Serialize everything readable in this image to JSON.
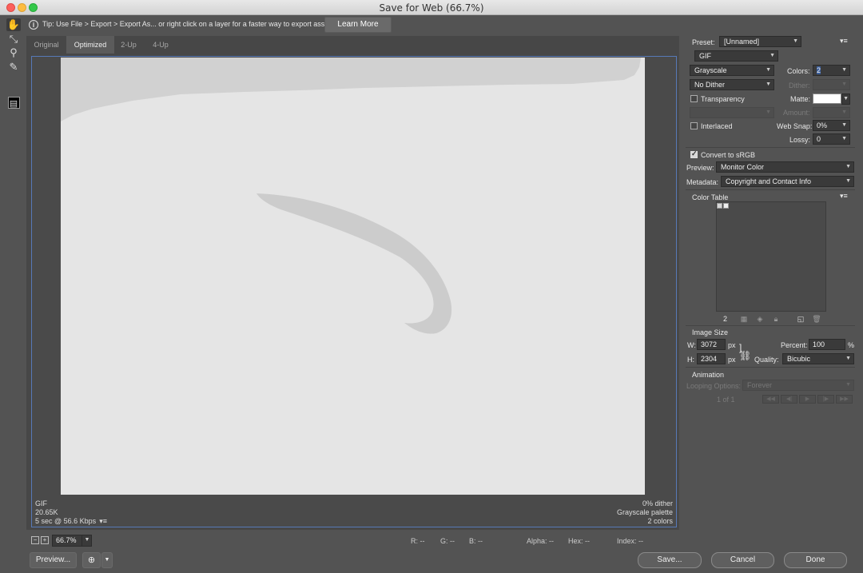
{
  "window": {
    "title": "Save for Web (66.7%)"
  },
  "tip": {
    "text": "Tip: Use File > Export > Export As...  or right click on a layer for a faster way to export assets",
    "button": "Learn More"
  },
  "tabs": [
    "Original",
    "Optimized",
    "2-Up",
    "4-Up"
  ],
  "view_info": {
    "format": "GIF",
    "size": "20.65K",
    "speed": "5 sec @ 56.6 Kbps",
    "dither": "0% dither",
    "palette": "Grayscale palette",
    "colors": "2 colors"
  },
  "zoom": {
    "value": "66.7%"
  },
  "readout": {
    "r": "R: --",
    "g": "G: --",
    "b": "B: --",
    "alpha": "Alpha: --",
    "hex": "Hex: --",
    "index": "Index: --"
  },
  "buttons": {
    "preview": "Preview...",
    "save": "Save...",
    "cancel": "Cancel",
    "done": "Done"
  },
  "settings": {
    "preset_label": "Preset:",
    "preset": "[Unnamed]",
    "format": "GIF",
    "reduction": "Grayscale",
    "colors_label": "Colors:",
    "colors": "2",
    "dither_algo": "No Dither",
    "dither_label": "Dither:",
    "transparency_label": "Transparency",
    "matte_label": "Matte:",
    "amount_label": "Amount:",
    "interlaced_label": "Interlaced",
    "websnap_label": "Web Snap:",
    "websnap": "0%",
    "lossy_label": "Lossy:",
    "lossy": "0",
    "srgb_label": "Convert to sRGB",
    "preview_label": "Preview:",
    "preview": "Monitor Color",
    "metadata_label": "Metadata:",
    "metadata": "Copyright and Contact Info"
  },
  "color_table": {
    "title": "Color Table",
    "count": "2"
  },
  "image_size": {
    "title": "Image Size",
    "w_label": "W:",
    "w": "3072",
    "h_label": "H:",
    "h": "2304",
    "unit": "px",
    "percent_label": "Percent:",
    "percent": "100",
    "percent_unit": "%",
    "quality_label": "Quality:",
    "quality": "Bicubic"
  },
  "animation": {
    "title": "Animation",
    "looping_label": "Looping Options:",
    "looping": "Forever",
    "frame": "1 of 1"
  }
}
